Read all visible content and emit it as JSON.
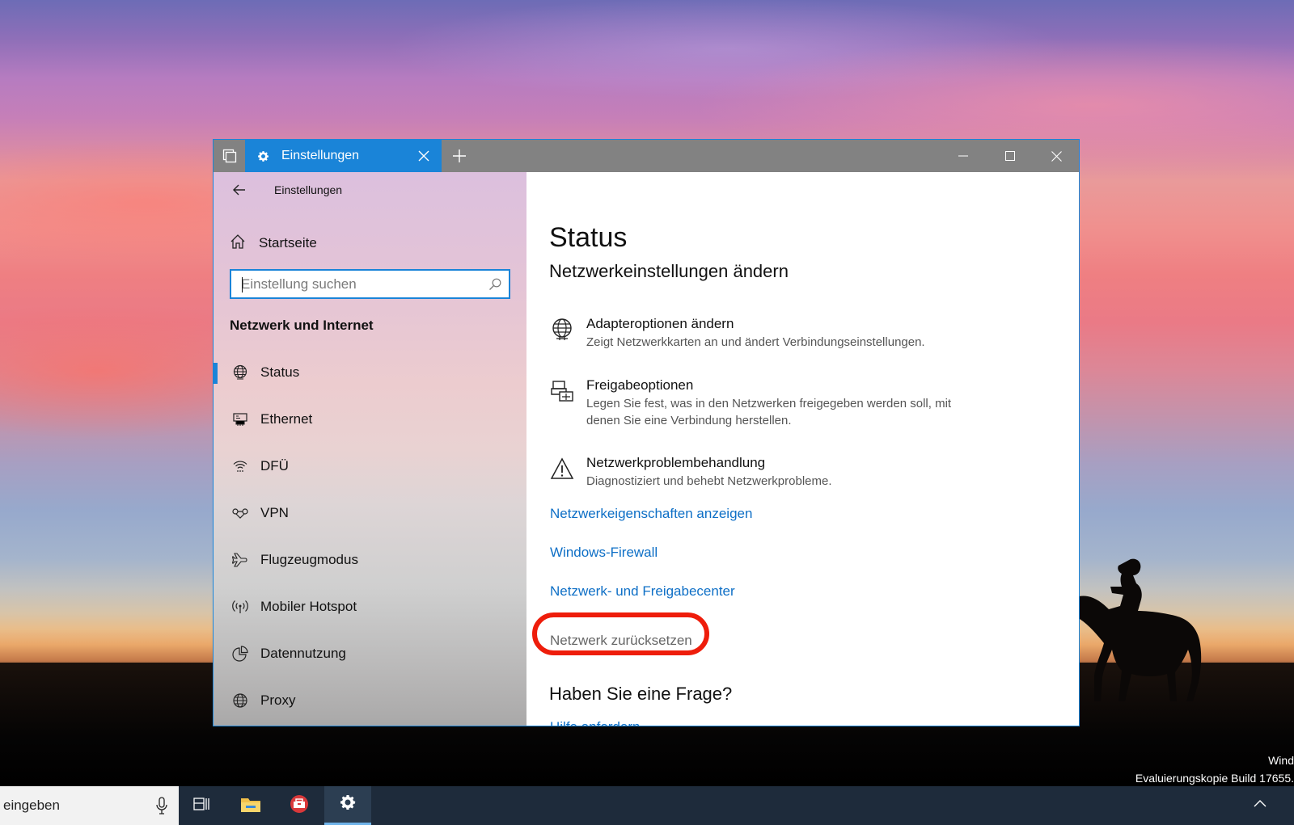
{
  "window": {
    "tab_title": "Einstellungen",
    "app_title": "Einstellungen"
  },
  "sidebar": {
    "home_label": "Startseite",
    "search_placeholder": "Einstellung suchen",
    "section_title": "Netzwerk und Internet",
    "items": [
      {
        "label": "Status",
        "icon": "globe-status-icon",
        "active": true
      },
      {
        "label": "Ethernet",
        "icon": "ethernet-icon"
      },
      {
        "label": "DFÜ",
        "icon": "dialup-icon"
      },
      {
        "label": "VPN",
        "icon": "vpn-icon"
      },
      {
        "label": "Flugzeugmodus",
        "icon": "airplane-icon"
      },
      {
        "label": "Mobiler Hotspot",
        "icon": "hotspot-icon"
      },
      {
        "label": "Datennutzung",
        "icon": "data-usage-icon"
      },
      {
        "label": "Proxy",
        "icon": "globe-icon"
      }
    ]
  },
  "content": {
    "title": "Status",
    "subtitle": "Netzwerkeinstellungen ändern",
    "options": [
      {
        "title": "Adapteroptionen ändern",
        "description": "Zeigt Netzwerkkarten an und ändert Verbindungseinstellungen.",
        "icon": "adapter-globe-icon"
      },
      {
        "title": "Freigabeoptionen",
        "description": "Legen Sie fest, was in den Netzwerken freigegeben werden soll, mit denen Sie eine Verbindung herstellen.",
        "icon": "sharing-icon"
      },
      {
        "title": "Netzwerkproblembehandlung",
        "description": "Diagnostiziert und behebt Netzwerkprobleme.",
        "icon": "warning-icon"
      }
    ],
    "links": [
      "Netzwerkeigenschaften anzeigen",
      "Windows-Firewall",
      "Netzwerk- und Freigabecenter"
    ],
    "reset_link": "Netzwerk zurücksetzen",
    "faq_heading": "Haben Sie eine Frage?",
    "help_link": "Hilfe anfordern"
  },
  "taskbar": {
    "search_text": "eingeben",
    "active_app": "settings"
  },
  "watermark": {
    "line1": "Wind",
    "line2": "Evaluierungskopie Build 17655."
  },
  "colors": {
    "accent": "#1a84d8",
    "link": "#0e6fc6",
    "highlight_ring": "#ee1d0b",
    "titlebar": "#828282",
    "taskbar": "#1e2b3b"
  }
}
